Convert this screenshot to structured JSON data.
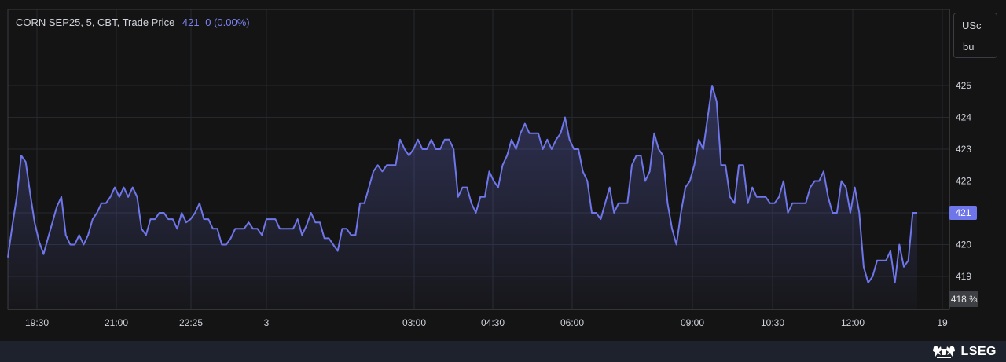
{
  "legend": {
    "title": "CORN SEP25, 5, CBT, Trade Price",
    "last": "421",
    "change": "0 (0.00%)"
  },
  "unit": {
    "line1": "USc",
    "line2": "bu"
  },
  "last_price_label": "421",
  "low_label": "418 ⅜",
  "brand": {
    "name": "LSEG",
    "logo_icon": "lion-unicorn-crest-icon"
  },
  "colors": {
    "line": "#6e76ea",
    "background": "#141414",
    "text": "#d1d4dc"
  },
  "chart_data": {
    "type": "line",
    "title": "CORN SEP25, 5, CBT, Trade Price",
    "xlabel": "",
    "ylabel": "USc/bu",
    "ylim": [
      418.25,
      426.1
    ],
    "y_ticks": [
      419,
      420,
      421,
      422,
      423,
      424,
      425
    ],
    "x_tick_labels": [
      "19:30",
      "21:00",
      "22:25",
      "3",
      "03:00",
      "04:30",
      "06:00",
      "09:00",
      "10:30",
      "12:00",
      "19"
    ],
    "grid": true,
    "last_value": 421,
    "series": [
      {
        "values": [
          419.6,
          420.6,
          421.5,
          422.8,
          422.6,
          421.6,
          420.7,
          420.1,
          419.7,
          420.2,
          420.7,
          421.2,
          421.5,
          420.3,
          420.0,
          420.0,
          420.3,
          420.0,
          420.3,
          420.8,
          421.0,
          421.3,
          421.3,
          421.5,
          421.8,
          421.5,
          421.8,
          421.5,
          421.8,
          421.5,
          420.5,
          420.3,
          420.8,
          420.8,
          421.0,
          421.0,
          420.8,
          420.8,
          420.5,
          421.0,
          420.7,
          420.8,
          421.0,
          421.3,
          420.8,
          420.8,
          420.5,
          420.5,
          420.0,
          420.0,
          420.2,
          420.5,
          420.5,
          420.5,
          420.7,
          420.5,
          420.5,
          420.3,
          420.8,
          420.8,
          420.8,
          420.5,
          420.5,
          420.5,
          420.5,
          420.8,
          420.3,
          420.6,
          421.0,
          420.7,
          420.7,
          420.2,
          420.2,
          420.0,
          419.8,
          420.5,
          420.5,
          420.3,
          420.3,
          421.3,
          421.3,
          421.8,
          422.3,
          422.5,
          422.3,
          422.5,
          422.5,
          422.5,
          423.3,
          423.0,
          422.8,
          423.0,
          423.3,
          423.0,
          423.0,
          423.3,
          423.0,
          423.0,
          423.3,
          423.3,
          423.0,
          421.5,
          421.8,
          421.8,
          421.3,
          421.0,
          421.5,
          421.5,
          422.3,
          422.0,
          421.8,
          422.5,
          422.8,
          423.3,
          423.0,
          423.5,
          423.8,
          423.5,
          423.5,
          423.5,
          423.0,
          423.3,
          423.0,
          423.3,
          423.5,
          424.0,
          423.3,
          423.0,
          423.0,
          422.3,
          422.0,
          421.0,
          421.0,
          420.8,
          421.3,
          421.8,
          421.0,
          421.3,
          421.3,
          421.3,
          422.5,
          422.8,
          422.8,
          422.0,
          422.3,
          423.5,
          423.0,
          422.8,
          421.3,
          420.5,
          420.0,
          421.0,
          421.8,
          422.0,
          422.5,
          423.3,
          423.0,
          424.0,
          425.0,
          424.5,
          422.5,
          422.5,
          421.5,
          421.3,
          422.5,
          422.5,
          421.3,
          421.8,
          421.5,
          421.5,
          421.5,
          421.3,
          421.3,
          421.5,
          422.0,
          421.0,
          421.3,
          421.3,
          421.3,
          421.3,
          421.8,
          422.0,
          422.0,
          422.3,
          421.5,
          421.0,
          421.0,
          422.0,
          421.8,
          421.0,
          421.8,
          421.0,
          419.3,
          418.8,
          419.0,
          419.5,
          419.5,
          419.5,
          419.8,
          418.8,
          420.0,
          419.3,
          419.5,
          421.0,
          421.0
        ]
      }
    ]
  }
}
